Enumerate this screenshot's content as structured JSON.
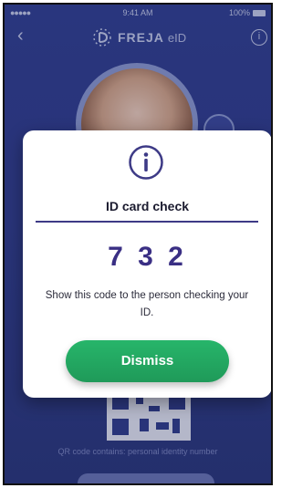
{
  "status_bar": {
    "signal": "●●●●● ",
    "time": "9:41 AM",
    "battery_text": "100%"
  },
  "nav": {
    "back_glyph": "‹",
    "brand_name": "FREJA",
    "brand_suffix": "eID",
    "info_glyph": "i"
  },
  "background": {
    "qr_caption": "QR code contains: personal identity number",
    "bottom_button_label": ""
  },
  "modal": {
    "icon": "info-icon",
    "title": "ID card check",
    "code": "732",
    "message": "Show this code to the person checking your ID.",
    "dismiss_label": "Dismiss"
  },
  "colors": {
    "accent": "#3a2f84",
    "button": "#1f9a59",
    "background": "#2f3c8c"
  }
}
